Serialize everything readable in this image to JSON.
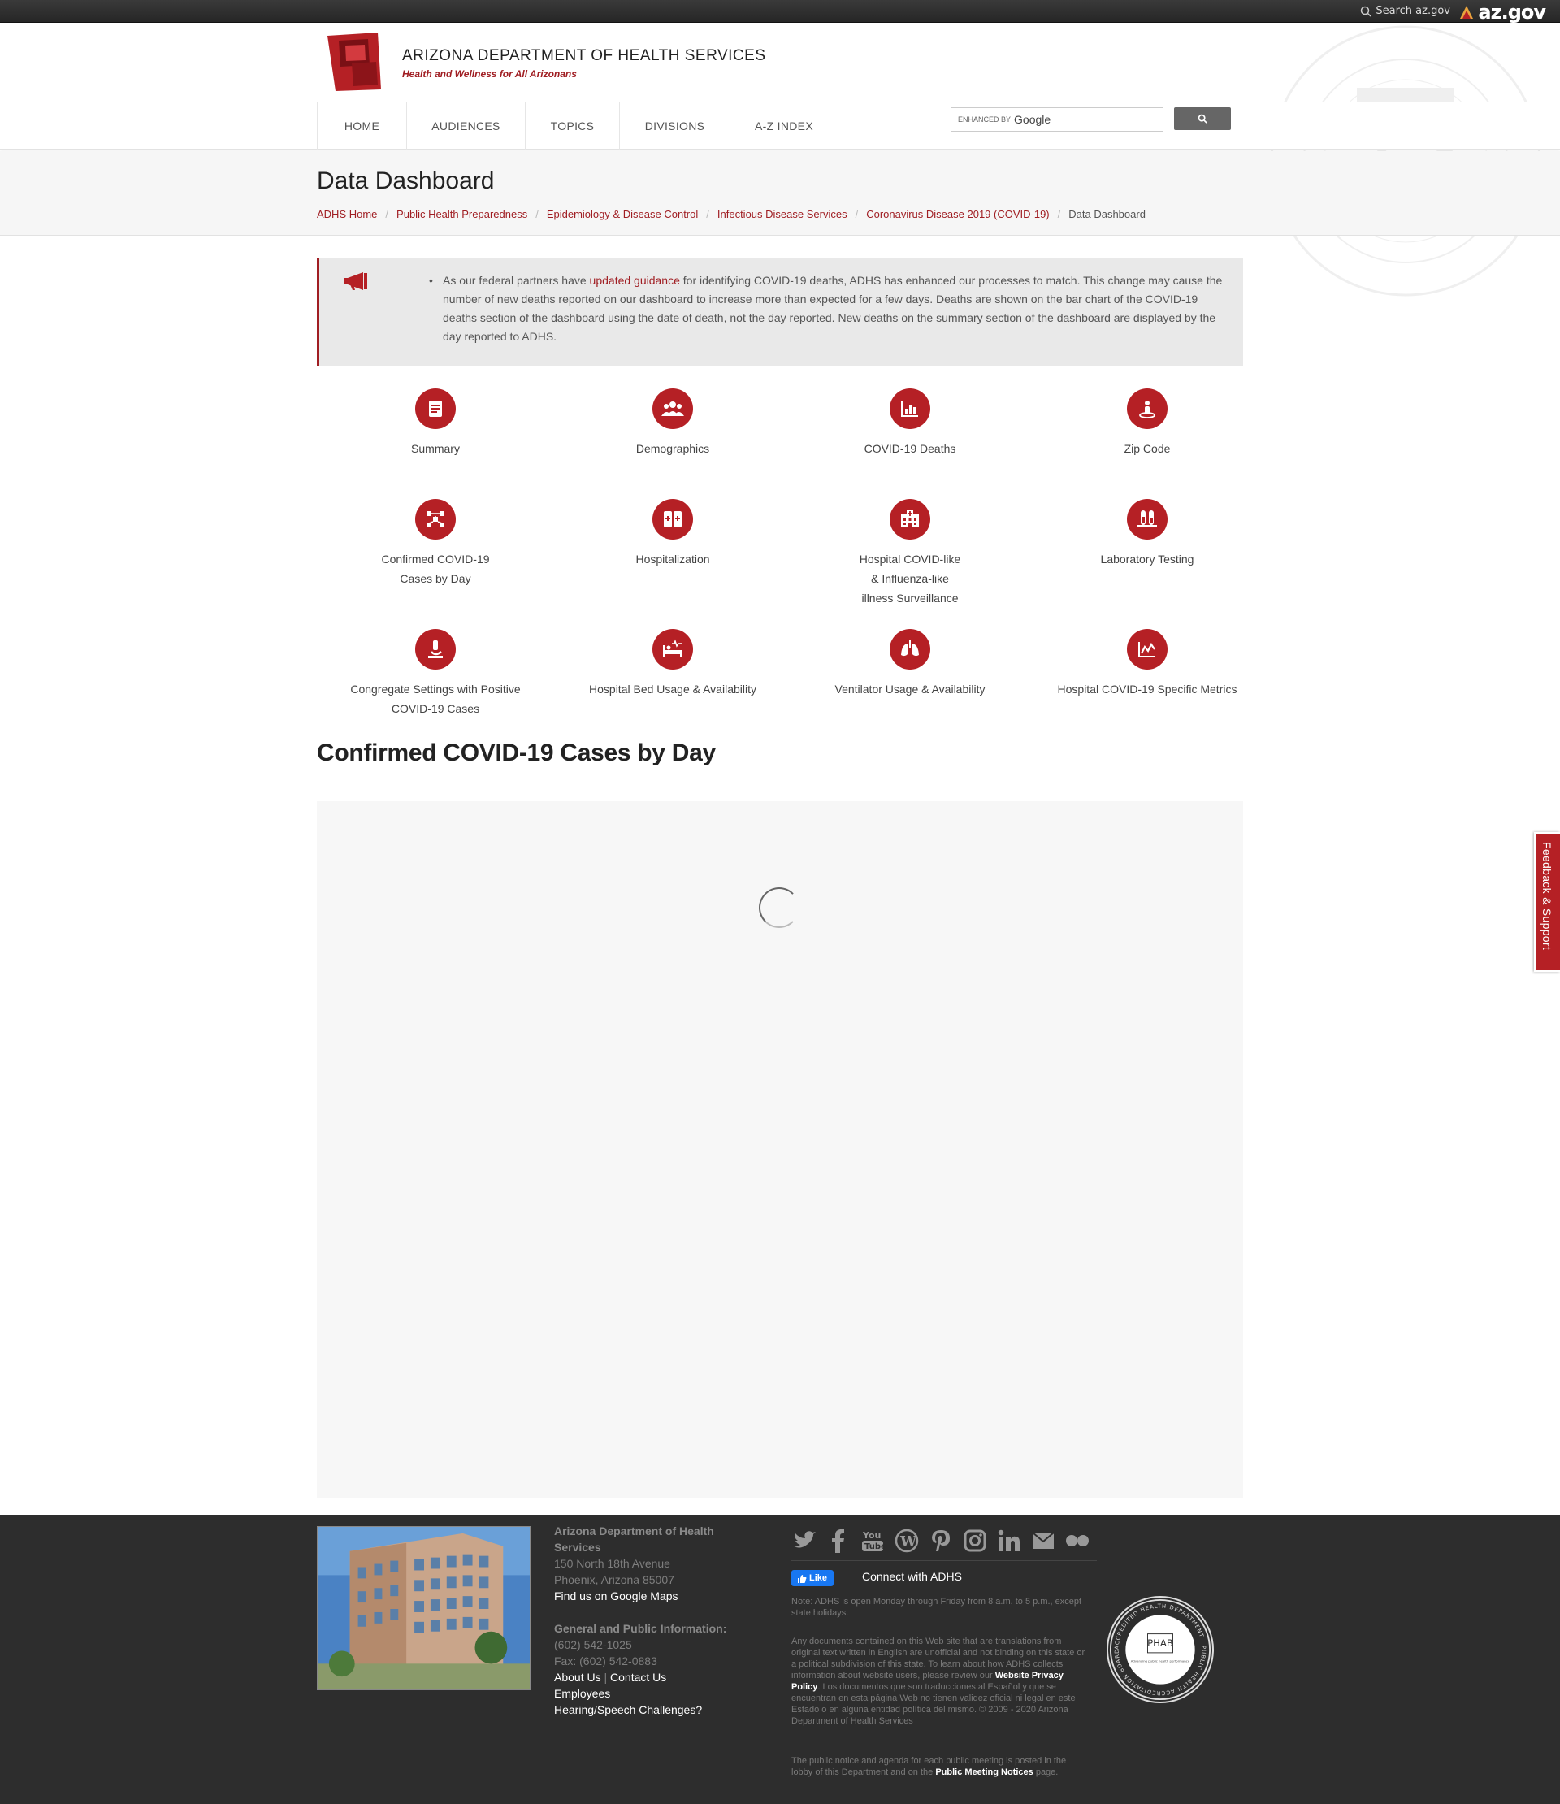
{
  "topbar": {
    "search_label": "Search az.gov",
    "brand": "az.gov"
  },
  "header": {
    "org_name": "ARIZONA DEPARTMENT OF HEALTH SERVICES",
    "tagline": "Health and Wellness for All Arizonans"
  },
  "nav": {
    "items": [
      {
        "label": "HOME"
      },
      {
        "label": "AUDIENCES"
      },
      {
        "label": "TOPICS"
      },
      {
        "label": "DIVISIONS"
      },
      {
        "label": "A-Z INDEX"
      }
    ],
    "search_enhanced": "ENHANCED BY",
    "search_brand": "Google"
  },
  "page": {
    "title": "Data Dashboard",
    "breadcrumb": [
      "ADHS Home",
      "Public Health Preparedness",
      "Epidemiology & Disease Control",
      "Infectious Disease Services",
      "Coronavirus Disease 2019 (COVID-19)"
    ],
    "breadcrumb_current": "Data Dashboard"
  },
  "alert": {
    "pre": "As our federal partners have ",
    "link": "updated guidance",
    "post": " for identifying COVID-19 deaths, ADHS has enhanced our processes to match. This change may cause the number of new deaths reported on our dashboard to increase more than expected for a few days. Deaths are shown on the bar chart of the COVID-19 deaths section of the dashboard using the date of death, not the day reported. New deaths on the summary section of the dashboard are displayed by the day reported to ADHS."
  },
  "tiles": [
    {
      "label": "Summary",
      "icon": "document-icon"
    },
    {
      "label": "Demographics",
      "icon": "people-icon"
    },
    {
      "label": "COVID-19 Deaths",
      "icon": "bar-chart-icon"
    },
    {
      "label": "Zip Code",
      "icon": "map-pin-person-icon"
    },
    {
      "label": "Confirmed COVID-19 Cases by Day",
      "line1": "Confirmed COVID-19",
      "line2": "Cases by Day",
      "icon": "network-icon"
    },
    {
      "label": "Hospitalization",
      "icon": "medical-kits-icon"
    },
    {
      "label": "Hospital COVID-like & Influenza-like illness Surveillance",
      "line1": "Hospital COVID-like",
      "line2": "& Influenza-like",
      "line3": "illness Surveillance",
      "icon": "hospital-icon"
    },
    {
      "label": "Laboratory Testing",
      "icon": "test-tubes-icon"
    },
    {
      "label": "Congregate Settings with Positive COVID-19 Cases",
      "line1": "Congregate Settings with Positive",
      "line2": "COVID-19 Cases",
      "icon": "microscope-icon"
    },
    {
      "label": "Hospital Bed Usage & Availability",
      "icon": "hospital-bed-icon"
    },
    {
      "label": "Ventilator Usage & Availability",
      "icon": "lungs-icon"
    },
    {
      "label": "Hospital COVID-19 Specific Metrics",
      "icon": "line-chart-icon"
    }
  ],
  "section": {
    "title": "Confirmed COVID-19 Cases by Day"
  },
  "feedback": {
    "label": "Feedback & Support"
  },
  "footer": {
    "org": "Arizona Department of Health Services",
    "address1": "150 North 18th Avenue",
    "address2": "Phoenix, Arizona 85007",
    "maps_link": "Find us on Google Maps",
    "info_heading": "General and Public Information:",
    "phone": "(602) 542-1025",
    "fax": "Fax: (602) 542-0883",
    "about": "About Us",
    "contact": "Contact Us",
    "employees": "Employees",
    "hearing": "Hearing/Speech Challenges?",
    "fb_like": "Like",
    "connect": "Connect with ADHS",
    "hours_note": "Note: ADHS is open Monday through Friday from 8 a.m. to 5 p.m., except state holidays.",
    "translation_note_pre": "Any documents contained on this Web site that are translations from original text written in English are unofficial and not binding on this state or a political subdivision of this state. To learn about how ADHS collects information about website users, please review our ",
    "privacy_link": "Website Privacy Policy",
    "translation_note_post": ". Los documentos que son traducciones al Español y que se encuentran en esta página Web no tienen validez oficial ni legal en este Estado o en alguna entidad política del mismo. © 2009 - 2020 Arizona Department of Health Services",
    "meeting_pre": "The public notice and agenda for each public meeting is posted in the lobby of this Department and on the ",
    "meeting_link": "Public Meeting Notices",
    "meeting_post": " page.",
    "phab_ring": "ACCREDITED HEALTH DEPARTMENT · PUBLIC HEALTH ACCREDITATION BOARD",
    "phab_mark": "PHAB",
    "phab_sub": "Advancing public health performance"
  },
  "colors": {
    "brand_red": "#b52025",
    "link_red": "#a01e23",
    "footer_bg": "#2d2d2d"
  }
}
